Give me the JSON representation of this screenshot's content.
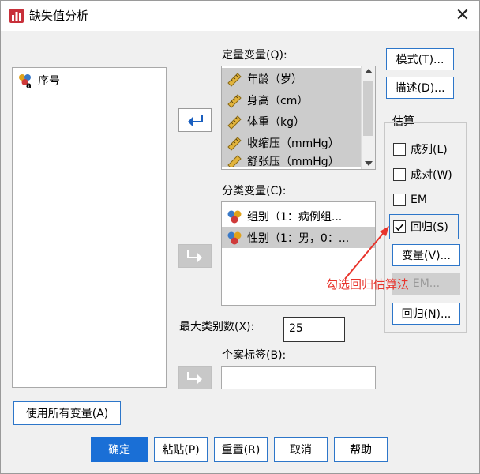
{
  "window": {
    "title": "缺失值分析",
    "close_glyph": "✕"
  },
  "left_list": {
    "items": [
      {
        "label": "序号"
      }
    ]
  },
  "quantitative": {
    "label": "定量变量(Q):",
    "items": [
      {
        "label": "年龄（岁）"
      },
      {
        "label": "身高（cm）"
      },
      {
        "label": "体重（kg）"
      },
      {
        "label": "收缩压（mmHg）"
      },
      {
        "label": "舒张压（mmHg）"
      }
    ]
  },
  "categorical": {
    "label": "分类变量(C):",
    "items": [
      {
        "label": "组别（1：病例组..."
      },
      {
        "label": "性别（1：男，0：..."
      }
    ]
  },
  "max_categories": {
    "label": "最大类别数(X):",
    "value": "25"
  },
  "case_label": {
    "label": "个案标签(B):",
    "value": ""
  },
  "side_buttons": {
    "patterns": "模式(T)...",
    "describe": "描述(D)..."
  },
  "estimation": {
    "title": "估算",
    "options": [
      {
        "label": "成列(L)",
        "checked": false
      },
      {
        "label": "成对(W)",
        "checked": false
      },
      {
        "label": "EM",
        "checked": false
      },
      {
        "label": "回归(S)",
        "checked": true
      }
    ],
    "variables_button": "变量(V)...",
    "em_button": "EM...",
    "regression_button": "回归(N)..."
  },
  "use_all_button": "使用所有变量(A)",
  "footer": {
    "ok": "确定",
    "paste": "粘贴(P)",
    "reset": "重置(R)",
    "cancel": "取消",
    "help": "帮助"
  },
  "annotation": {
    "text": "勾选回归估算法",
    "color": "#e8342c"
  },
  "colors": {
    "primary_blue": "#1a6fd6",
    "selection_gray": "#cccccc",
    "dialog_bg": "#f0f0f0"
  }
}
